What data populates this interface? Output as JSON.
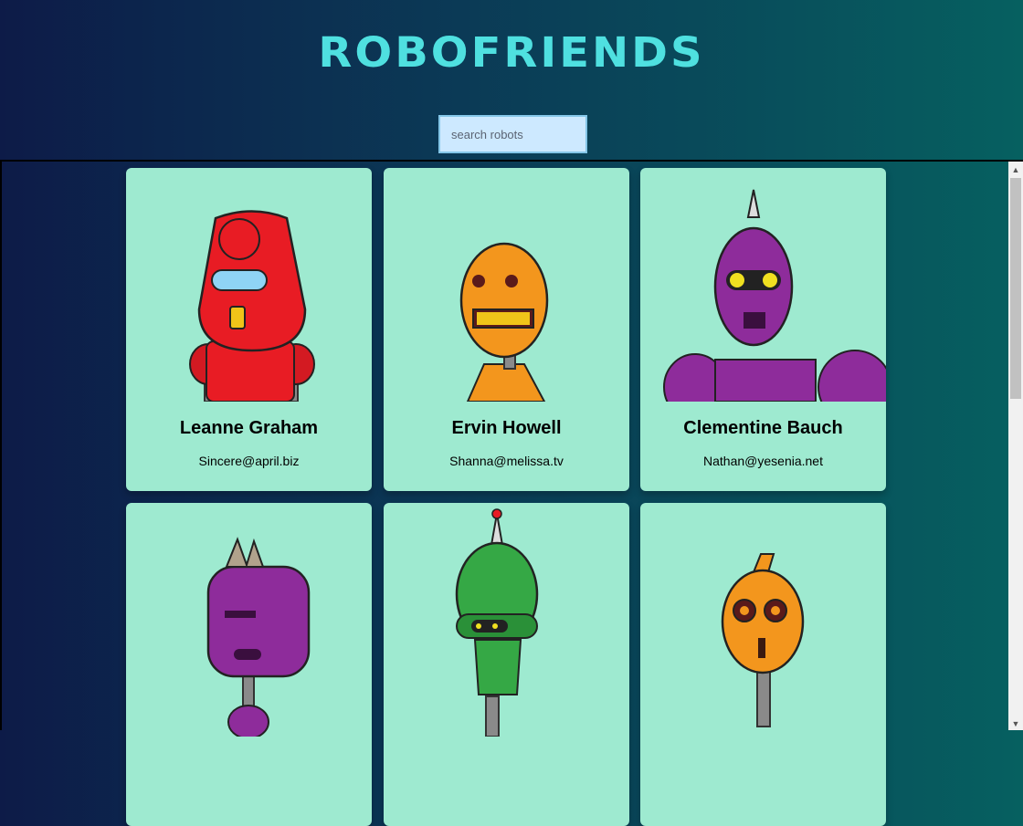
{
  "header": {
    "title": "ROBOFRIENDS"
  },
  "search": {
    "placeholder": "search robots",
    "value": ""
  },
  "robots": [
    {
      "name": "Leanne Graham",
      "email": "Sincere@april.biz",
      "color": "#e81c24"
    },
    {
      "name": "Ervin Howell",
      "email": "Shanna@melissa.tv",
      "color": "#f3961d"
    },
    {
      "name": "Clementine Bauch",
      "email": "Nathan@yesenia.net",
      "color": "#8e2c9b"
    },
    {
      "name": "",
      "email": "",
      "color": "#8e2c9b"
    },
    {
      "name": "",
      "email": "",
      "color": "#35a845"
    },
    {
      "name": "",
      "email": "",
      "color": "#f3961d"
    }
  ]
}
